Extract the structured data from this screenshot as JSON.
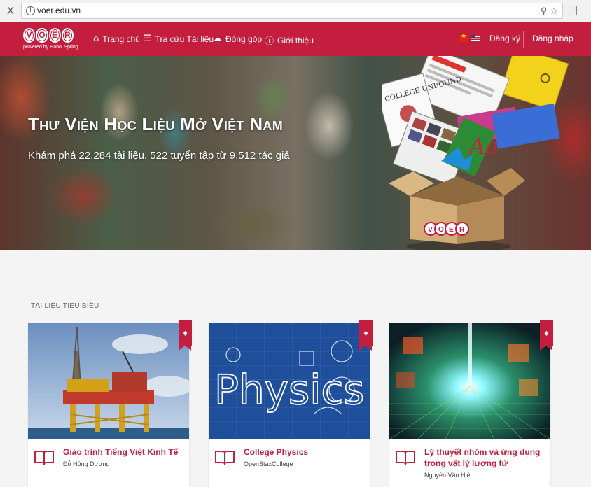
{
  "browser": {
    "close_label": "X",
    "url": "voer.edu.vn"
  },
  "nav": {
    "logo_letters": [
      "V",
      "O",
      "E",
      "R"
    ],
    "logo_tagline": "powered by Hanoi Spring",
    "items": [
      {
        "icon": "home-icon",
        "label": "Trang chủ"
      },
      {
        "icon": "list-icon",
        "label": "Tra cứu Tài liệu"
      },
      {
        "icon": "cloud-upload-icon",
        "label": "Đóng góp"
      },
      {
        "icon": "info-icon",
        "label": "Giới thiệu"
      }
    ],
    "register_label": "Đăng ký",
    "login_label": "Đăng nhập"
  },
  "hero": {
    "title": "Thư Viện Học Liệu Mở Việt Nam",
    "subtitle": "Khám phá 22.284 tài liệu, 522 tuyển tập từ 9.512 tác giả",
    "box_logo": "VOER",
    "book_text": "COLLEGE UNBOUND",
    "aa_text": "Aa"
  },
  "section": {
    "title": "TÀI LIỆU TIÊU BIỂU"
  },
  "cards": [
    {
      "title": "Giáo trình Tiếng Việt Kinh Tế",
      "author": "Đỗ Hồng Dương"
    },
    {
      "title": "College Physics",
      "author": "OpenStaxCollege",
      "image_text": "Physics"
    },
    {
      "title": "Lý thuyết nhóm và ứng dụng trong vật lý lượng tử",
      "author": "Nguyễn Văn Hiệu"
    }
  ],
  "colors": {
    "brand": "#c41e3f",
    "background": "#f4f4f4"
  }
}
